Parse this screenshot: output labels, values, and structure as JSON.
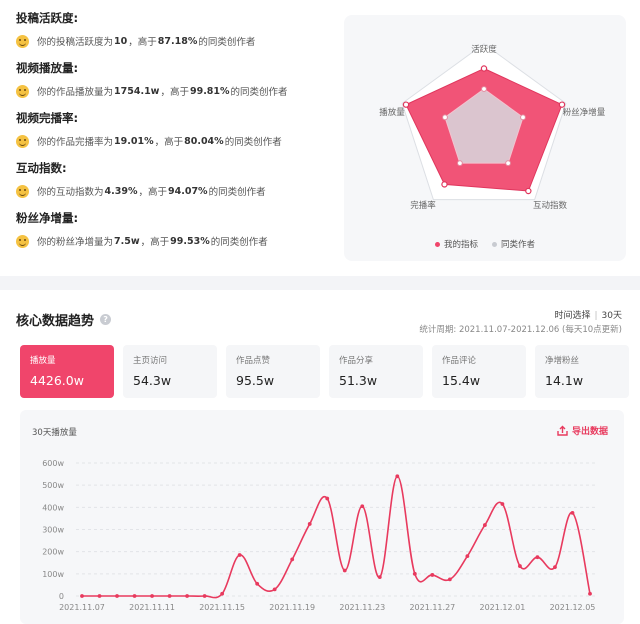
{
  "metrics": [
    {
      "title": "投稿活跃度:",
      "pre": "你的投稿活跃度为",
      "value": "10",
      "mid": "，高于",
      "pct": "87.18%",
      "post": "的同类创作者"
    },
    {
      "title": "视频播放量:",
      "pre": "你的作品播放量为",
      "value": "1754.1w",
      "mid": "，高于",
      "pct": "99.81%",
      "post": "的同类创作者"
    },
    {
      "title": "视频完播率:",
      "pre": "你的作品完播率为",
      "value": "19.01%",
      "mid": "，高于",
      "pct": "80.04%",
      "post": "的同类创作者"
    },
    {
      "title": "互动指数:",
      "pre": "你的互动指数为",
      "value": "4.39%",
      "mid": "，高于",
      "pct": "94.07%",
      "post": "的同类创作者"
    },
    {
      "title": "粉丝净增量:",
      "pre": "你的粉丝净增量为",
      "value": "7.5w",
      "mid": "，高于",
      "pct": "99.53%",
      "post": "的同类创作者"
    }
  ],
  "radar": {
    "axes": [
      "活跃度",
      "粉丝净增量",
      "互动指数",
      "完播率",
      "播放量"
    ],
    "mine": [
      0.75,
      1.0,
      0.92,
      0.82,
      1.0
    ],
    "peers": [
      0.5,
      0.5,
      0.5,
      0.5,
      0.5
    ],
    "legend_mine": "我的指标",
    "legend_peers": "同类作者",
    "color_mine": "#f0456b",
    "color_peers": "#d7d9de"
  },
  "section_title": "核心数据趋势",
  "help_icon": "?",
  "time_select": {
    "label": "时间选择",
    "value": "30天"
  },
  "stat_period": "统计周期: 2021.11.07-2021.12.06 (每天10点更新)",
  "cards": [
    {
      "label": "播放量",
      "value": "4426.0w",
      "active": true
    },
    {
      "label": "主页访问",
      "value": "54.3w"
    },
    {
      "label": "作品点赞",
      "value": "95.5w"
    },
    {
      "label": "作品分享",
      "value": "51.3w"
    },
    {
      "label": "作品评论",
      "value": "15.4w"
    },
    {
      "label": "净增粉丝",
      "value": "14.1w"
    }
  ],
  "chart_title": "30天播放量",
  "export_label": "导出数据",
  "chart_data": {
    "type": "line",
    "x": [
      "2021.11.07",
      "2021.11.08",
      "2021.11.09",
      "2021.11.10",
      "2021.11.11",
      "2021.11.12",
      "2021.11.13",
      "2021.11.14",
      "2021.11.15",
      "2021.11.16",
      "2021.11.17",
      "2021.11.18",
      "2021.11.19",
      "2021.11.20",
      "2021.11.21",
      "2021.11.22",
      "2021.11.23",
      "2021.11.24",
      "2021.11.25",
      "2021.11.26",
      "2021.11.27",
      "2021.11.28",
      "2021.11.29",
      "2021.11.30",
      "2021.12.01",
      "2021.12.02",
      "2021.12.03",
      "2021.12.04",
      "2021.12.05",
      "2021.12.06"
    ],
    "values": [
      0,
      0,
      0,
      0,
      0,
      0,
      0,
      0,
      10,
      185,
      55,
      30,
      165,
      325,
      440,
      115,
      405,
      85,
      540,
      100,
      95,
      75,
      180,
      320,
      415,
      135,
      175,
      130,
      375,
      10
    ],
    "x_tick_labels": [
      "2021.11.07",
      "2021.11.11",
      "2021.11.15",
      "2021.11.19",
      "2021.11.23",
      "2021.11.27",
      "2021.12.01",
      "2021.12.05"
    ],
    "y_ticks": [
      0,
      100,
      200,
      300,
      400,
      500,
      600
    ],
    "y_tick_labels": [
      "0",
      "100w",
      "200w",
      "300w",
      "400w",
      "500w",
      "600w"
    ],
    "ylim": [
      0,
      600
    ],
    "grid": true,
    "color": "#e83a5e"
  }
}
